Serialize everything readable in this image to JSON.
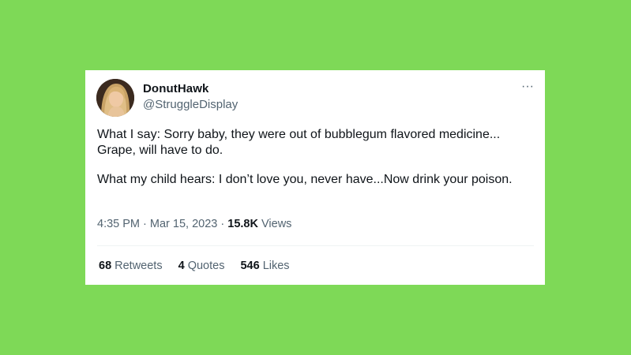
{
  "tweet": {
    "display_name": "DonutHawk",
    "handle": "@StruggleDisplay",
    "more_glyph": "···",
    "paragraphs": [
      "What I say: Sorry baby, they were out of bubblegum flavored medicine... Grape, will have to do.",
      "What my child hears: I don’t love you, never have...Now drink your poison."
    ],
    "time": "4:35 PM",
    "separator": "·",
    "date": "Mar 15, 2023",
    "views_count": "15.8K",
    "views_label": "Views"
  },
  "stats": [
    {
      "count": "68",
      "label": "Retweets"
    },
    {
      "count": "4",
      "label": "Quotes"
    },
    {
      "count": "546",
      "label": "Likes"
    }
  ],
  "colors": {
    "background": "#7ed957",
    "card": "#ffffff",
    "primary_text": "#0f1419",
    "secondary_text": "#536471"
  },
  "icons": {
    "avatar": "profile-photo",
    "more": "more-options-icon"
  }
}
